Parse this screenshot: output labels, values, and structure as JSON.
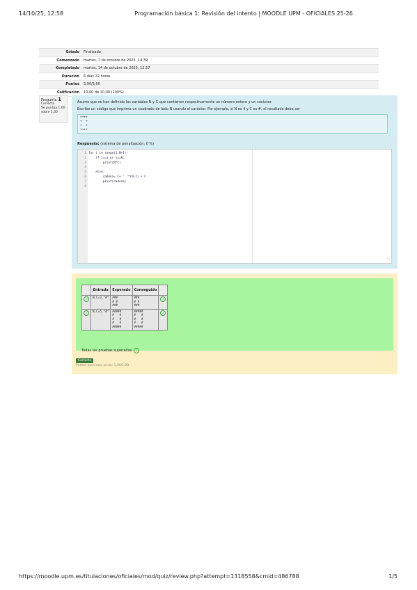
{
  "header": {
    "datetime": "14/10/25, 12:58",
    "title": "Programación básica 1: Revisión del intento | MOODLE UPM - OFICIALES 25-26"
  },
  "summary": [
    {
      "label": "Estado",
      "value": "Finalizado"
    },
    {
      "label": "Comenzado",
      "value": "martes, 7 de octubre de 2025, 14:39"
    },
    {
      "label": "Completado",
      "value": "martes, 14 de octubre de 2025, 12:57"
    },
    {
      "label": "Duración",
      "value": "6 días 22 horas"
    },
    {
      "label": "Puntos",
      "value": "5,00/5,00"
    },
    {
      "label": "Calificación",
      "value": "10,00 de 10,00 (100%)"
    }
  ],
  "question_info": {
    "label": "Pregunta",
    "number": "1",
    "state": "Correcta",
    "marks": "Se puntúa 1,00 sobre 1,00"
  },
  "question": {
    "text1": "Asume que se han definido las variables N y C que contienen respectivamente un número entero y un carácter.",
    "text2": "Escribe un código que imprima un cuadrado de lado N usando el carácter. Por ejemplo, si N es 4 y C es #, el resultado debe ser",
    "sample": "++++\n+  +\n+  +\n++++",
    "answer_label": "Respuesta:",
    "penalty": "(sistema de penalización: 0 %)"
  },
  "code_lines": [
    {
      "n": "1",
      "code": "for i in range(1,N+1):"
    },
    {
      "n": "2",
      "code": "    if i==1 or i==N:"
    },
    {
      "n": "3",
      "code": "        print(N*C)"
    },
    {
      "n": "4",
      "code": ""
    },
    {
      "n": "5",
      "code": "    else:"
    },
    {
      "n": "6",
      "code": "        cadena= C+ ' '*(N-2) + C"
    },
    {
      "n": "7",
      "code": "        print(cadena)"
    },
    {
      "n": "8",
      "code": ""
    }
  ],
  "tests": {
    "headers": [
      "Entrada",
      "Esperado",
      "Conseguido"
    ],
    "rows": [
      {
        "input": "N,C=3,\"#\"",
        "expected": "###\n# #\n###",
        "got": "###\n# #\n###"
      },
      {
        "input": "N,C=5,\"#\"",
        "expected": "#####\n#   #\n#   #\n#   #\n#####",
        "got": "#####\n#   #\n#   #\n#   #\n#####"
      }
    ],
    "all_passed": "Todas las pruebas superadas."
  },
  "feedback": {
    "badge": "Correcta",
    "marks": "Puntos para este envío: 1,00/1,00."
  },
  "footer": {
    "url": "https://moodle.upm.es/titulaciones/oficiales/mod/quiz/review.php?attempt=1318558&cmid=486788",
    "page": "1/5"
  }
}
